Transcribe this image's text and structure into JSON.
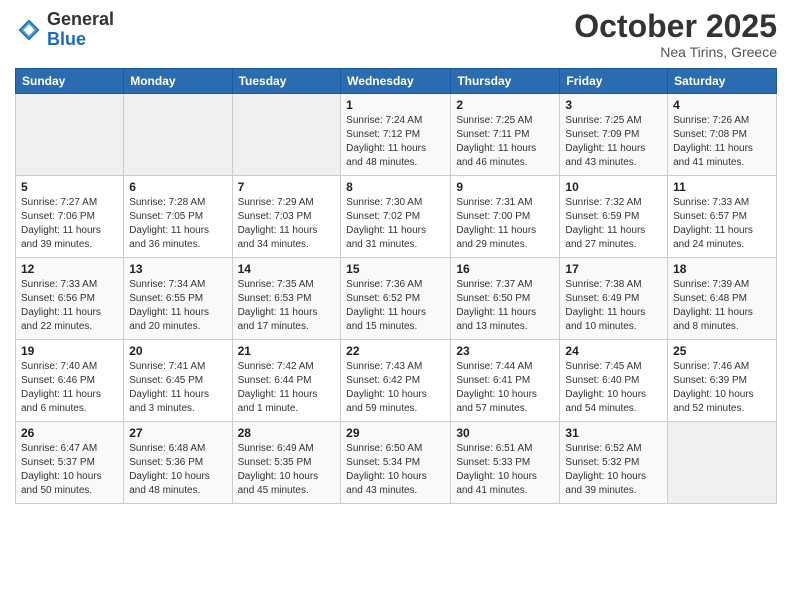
{
  "logo": {
    "general": "General",
    "blue": "Blue"
  },
  "header": {
    "month": "October 2025",
    "location": "Nea Tirins, Greece"
  },
  "weekdays": [
    "Sunday",
    "Monday",
    "Tuesday",
    "Wednesday",
    "Thursday",
    "Friday",
    "Saturday"
  ],
  "weeks": [
    [
      {
        "day": "",
        "sunrise": "",
        "sunset": "",
        "daylight": ""
      },
      {
        "day": "",
        "sunrise": "",
        "sunset": "",
        "daylight": ""
      },
      {
        "day": "",
        "sunrise": "",
        "sunset": "",
        "daylight": ""
      },
      {
        "day": "1",
        "sunrise": "Sunrise: 7:24 AM",
        "sunset": "Sunset: 7:12 PM",
        "daylight": "Daylight: 11 hours and 48 minutes."
      },
      {
        "day": "2",
        "sunrise": "Sunrise: 7:25 AM",
        "sunset": "Sunset: 7:11 PM",
        "daylight": "Daylight: 11 hours and 46 minutes."
      },
      {
        "day": "3",
        "sunrise": "Sunrise: 7:25 AM",
        "sunset": "Sunset: 7:09 PM",
        "daylight": "Daylight: 11 hours and 43 minutes."
      },
      {
        "day": "4",
        "sunrise": "Sunrise: 7:26 AM",
        "sunset": "Sunset: 7:08 PM",
        "daylight": "Daylight: 11 hours and 41 minutes."
      }
    ],
    [
      {
        "day": "5",
        "sunrise": "Sunrise: 7:27 AM",
        "sunset": "Sunset: 7:06 PM",
        "daylight": "Daylight: 11 hours and 39 minutes."
      },
      {
        "day": "6",
        "sunrise": "Sunrise: 7:28 AM",
        "sunset": "Sunset: 7:05 PM",
        "daylight": "Daylight: 11 hours and 36 minutes."
      },
      {
        "day": "7",
        "sunrise": "Sunrise: 7:29 AM",
        "sunset": "Sunset: 7:03 PM",
        "daylight": "Daylight: 11 hours and 34 minutes."
      },
      {
        "day": "8",
        "sunrise": "Sunrise: 7:30 AM",
        "sunset": "Sunset: 7:02 PM",
        "daylight": "Daylight: 11 hours and 31 minutes."
      },
      {
        "day": "9",
        "sunrise": "Sunrise: 7:31 AM",
        "sunset": "Sunset: 7:00 PM",
        "daylight": "Daylight: 11 hours and 29 minutes."
      },
      {
        "day": "10",
        "sunrise": "Sunrise: 7:32 AM",
        "sunset": "Sunset: 6:59 PM",
        "daylight": "Daylight: 11 hours and 27 minutes."
      },
      {
        "day": "11",
        "sunrise": "Sunrise: 7:33 AM",
        "sunset": "Sunset: 6:57 PM",
        "daylight": "Daylight: 11 hours and 24 minutes."
      }
    ],
    [
      {
        "day": "12",
        "sunrise": "Sunrise: 7:33 AM",
        "sunset": "Sunset: 6:56 PM",
        "daylight": "Daylight: 11 hours and 22 minutes."
      },
      {
        "day": "13",
        "sunrise": "Sunrise: 7:34 AM",
        "sunset": "Sunset: 6:55 PM",
        "daylight": "Daylight: 11 hours and 20 minutes."
      },
      {
        "day": "14",
        "sunrise": "Sunrise: 7:35 AM",
        "sunset": "Sunset: 6:53 PM",
        "daylight": "Daylight: 11 hours and 17 minutes."
      },
      {
        "day": "15",
        "sunrise": "Sunrise: 7:36 AM",
        "sunset": "Sunset: 6:52 PM",
        "daylight": "Daylight: 11 hours and 15 minutes."
      },
      {
        "day": "16",
        "sunrise": "Sunrise: 7:37 AM",
        "sunset": "Sunset: 6:50 PM",
        "daylight": "Daylight: 11 hours and 13 minutes."
      },
      {
        "day": "17",
        "sunrise": "Sunrise: 7:38 AM",
        "sunset": "Sunset: 6:49 PM",
        "daylight": "Daylight: 11 hours and 10 minutes."
      },
      {
        "day": "18",
        "sunrise": "Sunrise: 7:39 AM",
        "sunset": "Sunset: 6:48 PM",
        "daylight": "Daylight: 11 hours and 8 minutes."
      }
    ],
    [
      {
        "day": "19",
        "sunrise": "Sunrise: 7:40 AM",
        "sunset": "Sunset: 6:46 PM",
        "daylight": "Daylight: 11 hours and 6 minutes."
      },
      {
        "day": "20",
        "sunrise": "Sunrise: 7:41 AM",
        "sunset": "Sunset: 6:45 PM",
        "daylight": "Daylight: 11 hours and 3 minutes."
      },
      {
        "day": "21",
        "sunrise": "Sunrise: 7:42 AM",
        "sunset": "Sunset: 6:44 PM",
        "daylight": "Daylight: 11 hours and 1 minute."
      },
      {
        "day": "22",
        "sunrise": "Sunrise: 7:43 AM",
        "sunset": "Sunset: 6:42 PM",
        "daylight": "Daylight: 10 hours and 59 minutes."
      },
      {
        "day": "23",
        "sunrise": "Sunrise: 7:44 AM",
        "sunset": "Sunset: 6:41 PM",
        "daylight": "Daylight: 10 hours and 57 minutes."
      },
      {
        "day": "24",
        "sunrise": "Sunrise: 7:45 AM",
        "sunset": "Sunset: 6:40 PM",
        "daylight": "Daylight: 10 hours and 54 minutes."
      },
      {
        "day": "25",
        "sunrise": "Sunrise: 7:46 AM",
        "sunset": "Sunset: 6:39 PM",
        "daylight": "Daylight: 10 hours and 52 minutes."
      }
    ],
    [
      {
        "day": "26",
        "sunrise": "Sunrise: 6:47 AM",
        "sunset": "Sunset: 5:37 PM",
        "daylight": "Daylight: 10 hours and 50 minutes."
      },
      {
        "day": "27",
        "sunrise": "Sunrise: 6:48 AM",
        "sunset": "Sunset: 5:36 PM",
        "daylight": "Daylight: 10 hours and 48 minutes."
      },
      {
        "day": "28",
        "sunrise": "Sunrise: 6:49 AM",
        "sunset": "Sunset: 5:35 PM",
        "daylight": "Daylight: 10 hours and 45 minutes."
      },
      {
        "day": "29",
        "sunrise": "Sunrise: 6:50 AM",
        "sunset": "Sunset: 5:34 PM",
        "daylight": "Daylight: 10 hours and 43 minutes."
      },
      {
        "day": "30",
        "sunrise": "Sunrise: 6:51 AM",
        "sunset": "Sunset: 5:33 PM",
        "daylight": "Daylight: 10 hours and 41 minutes."
      },
      {
        "day": "31",
        "sunrise": "Sunrise: 6:52 AM",
        "sunset": "Sunset: 5:32 PM",
        "daylight": "Daylight: 10 hours and 39 minutes."
      },
      {
        "day": "",
        "sunrise": "",
        "sunset": "",
        "daylight": ""
      }
    ]
  ]
}
